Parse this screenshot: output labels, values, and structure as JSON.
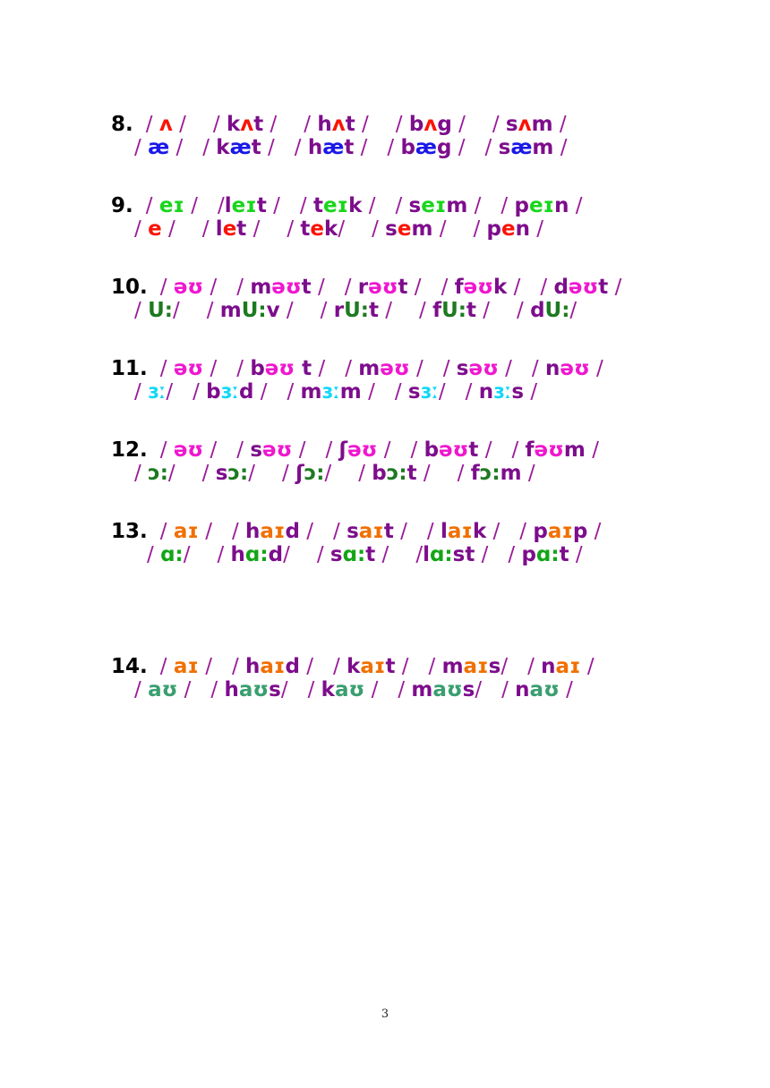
{
  "page": {
    "number": "3",
    "background": "#ffffff"
  },
  "colors": {
    "consonant_purple": "#7d0d8c",
    "slash_purple": "#9a1b9a",
    "red": "#fa1405",
    "blue": "#1a18e8",
    "bright_green": "#19d61c",
    "magenta": "#ef17cf",
    "dark_green": "#1d7a20",
    "cyan": "#14d8f7",
    "orange": "#f07000",
    "sea_green": "#3a9e70",
    "number_black": "#000000"
  },
  "exercises": [
    {
      "number": "8.",
      "rows": [
        {
          "vowel_color": "red",
          "items": [
            {
              "text": "/ ʌ /",
              "vowel": "ʌ"
            },
            {
              "text": "/ kʌt /",
              "vowel": "ʌ"
            },
            {
              "text": "/ hʌt /",
              "vowel": "ʌ"
            },
            {
              "text": "/ bʌg /",
              "vowel": "ʌ"
            },
            {
              "text": "/ sʌm /",
              "vowel": "ʌ"
            }
          ]
        },
        {
          "vowel_color": "blue",
          "items": [
            {
              "text": "/ æ /",
              "vowel": "æ"
            },
            {
              "text": "/ kæt /",
              "vowel": "æ"
            },
            {
              "text": "/ hæt /",
              "vowel": "æ"
            },
            {
              "text": "/ bæg /",
              "vowel": "æ"
            },
            {
              "text": "/ sæm /",
              "vowel": "æ"
            }
          ]
        }
      ]
    },
    {
      "number": "9.",
      "rows": [
        {
          "vowel_color": "bright_green",
          "items": [
            {
              "text": "/ eɪ /",
              "vowel": "eɪ"
            },
            {
              "text": "/leɪt /",
              "vowel": "eɪ"
            },
            {
              "text": "/ teɪk /",
              "vowel": "eɪ"
            },
            {
              "text": "/ seɪm /",
              "vowel": "eɪ"
            },
            {
              "text": "/ peɪn /",
              "vowel": "eɪ"
            }
          ]
        },
        {
          "vowel_color": "red",
          "items": [
            {
              "text": "/ e /",
              "vowel": "e"
            },
            {
              "text": "/ let /",
              "vowel": "e"
            },
            {
              "text": "/ tek/",
              "vowel": "e"
            },
            {
              "text": "/ sem /",
              "vowel": "e"
            },
            {
              "text": "/ pen /",
              "vowel": "e"
            }
          ]
        }
      ]
    },
    {
      "number": "10.",
      "rows": [
        {
          "vowel_color": "magenta",
          "items": [
            {
              "text": "/ əʊ /",
              "vowel": "əʊ"
            },
            {
              "text": "/ məʊt /",
              "vowel": "əʊ"
            },
            {
              "text": "/ rəʊt /",
              "vowel": "əʊ"
            },
            {
              "text": "/ fəʊk /",
              "vowel": "əʊ"
            },
            {
              "text": "/ dəʊt /",
              "vowel": "əʊ"
            }
          ]
        },
        {
          "vowel_color": "dark_green",
          "items": [
            {
              "text": "/ U:/",
              "vowel": "U:"
            },
            {
              "text": "/ mU:v /",
              "vowel": "U:"
            },
            {
              "text": "/ rU:t /",
              "vowel": "U:"
            },
            {
              "text": "/ fU:t /",
              "vowel": "U:"
            },
            {
              "text": "/ dU:/",
              "vowel": "U:"
            }
          ]
        }
      ]
    },
    {
      "number": "11.",
      "rows": [
        {
          "vowel_color": "magenta",
          "items": [
            {
              "text": "/ əʊ /",
              "vowel": "əʊ"
            },
            {
              "text": "/ bəʊ t /",
              "vowel": "əʊ"
            },
            {
              "text": "/ məʊ /",
              "vowel": "əʊ"
            },
            {
              "text": "/ səʊ /",
              "vowel": "əʊ"
            },
            {
              "text": "/ nəʊ /",
              "vowel": "əʊ"
            }
          ]
        },
        {
          "vowel_color": "cyan",
          "items": [
            {
              "text": "/ ɜː/",
              "vowel": "ɜː"
            },
            {
              "text": "/ bɜːd /",
              "vowel": "ɜː"
            },
            {
              "text": "/ mɜːm /",
              "vowel": "ɜː"
            },
            {
              "text": "/ sɜː/",
              "vowel": "ɜː"
            },
            {
              "text": "/ nɜːs /",
              "vowel": "ɜː"
            }
          ]
        }
      ]
    },
    {
      "number": "12.",
      "rows": [
        {
          "vowel_color": "magenta",
          "items": [
            {
              "text": "/ əʊ /",
              "vowel": "əʊ"
            },
            {
              "text": "/ səʊ /",
              "vowel": "əʊ"
            },
            {
              "text": "/ ʃəʊ /",
              "vowel": "əʊ"
            },
            {
              "text": "/ bəʊt /",
              "vowel": "əʊ"
            },
            {
              "text": "/ fəʊm /",
              "vowel": "əʊ"
            }
          ]
        },
        {
          "vowel_color": "dark_green",
          "items": [
            {
              "text": "/ ɔ:/",
              "vowel": "ɔ:"
            },
            {
              "text": "/ sɔ:/",
              "vowel": "ɔ:"
            },
            {
              "text": "/ ʃɔ:/",
              "vowel": "ɔ:"
            },
            {
              "text": "/ bɔ:t /",
              "vowel": "ɔ:"
            },
            {
              "text": "/ fɔ:m /",
              "vowel": "ɔ:"
            }
          ]
        }
      ]
    },
    {
      "number": "13.",
      "rows": [
        {
          "vowel_color": "orange",
          "items": [
            {
              "text": "/ aɪ /",
              "vowel": "aɪ"
            },
            {
              "text": "/ haɪd /",
              "vowel": "aɪ"
            },
            {
              "text": "/ saɪt /",
              "vowel": "aɪ"
            },
            {
              "text": "/ laɪk /",
              "vowel": "aɪ"
            },
            {
              "text": "/ paɪp /",
              "vowel": "aɪ"
            }
          ]
        },
        {
          "vowel_color": "bright_green",
          "items": [
            {
              "text": "/ ɑ:/",
              "vowel": "ɑ:"
            },
            {
              "text": "/ hɑ:d/",
              "vowel": "ɑ:"
            },
            {
              "text": "/ sɑ:t /",
              "vowel": "ɑ:"
            },
            {
              "text": "/lɑ:st /",
              "vowel": "ɑ:"
            },
            {
              "text": "/ pɑ:t /",
              "vowel": "ɑ:"
            }
          ]
        }
      ]
    },
    {
      "number": "14.",
      "rows": [
        {
          "vowel_color": "orange",
          "items": [
            {
              "text": "/ aɪ /",
              "vowel": "aɪ"
            },
            {
              "text": "/ haɪd /",
              "vowel": "aɪ"
            },
            {
              "text": "/ kaɪt /",
              "vowel": "aɪ"
            },
            {
              "text": "/ maɪs/",
              "vowel": "aɪ"
            },
            {
              "text": "/ naɪ /",
              "vowel": "aɪ"
            }
          ]
        },
        {
          "vowel_color": "sea_green",
          "items": [
            {
              "text": "/ aʊ /",
              "vowel": "aʊ"
            },
            {
              "text": "/ haʊs/",
              "vowel": "aʊ"
            },
            {
              "text": "/ kaʊ /",
              "vowel": "aʊ"
            },
            {
              "text": "/ maʊs/",
              "vowel": "aʊ"
            },
            {
              "text": "/ naʊ /",
              "vowel": "aʊ"
            }
          ]
        }
      ]
    }
  ]
}
